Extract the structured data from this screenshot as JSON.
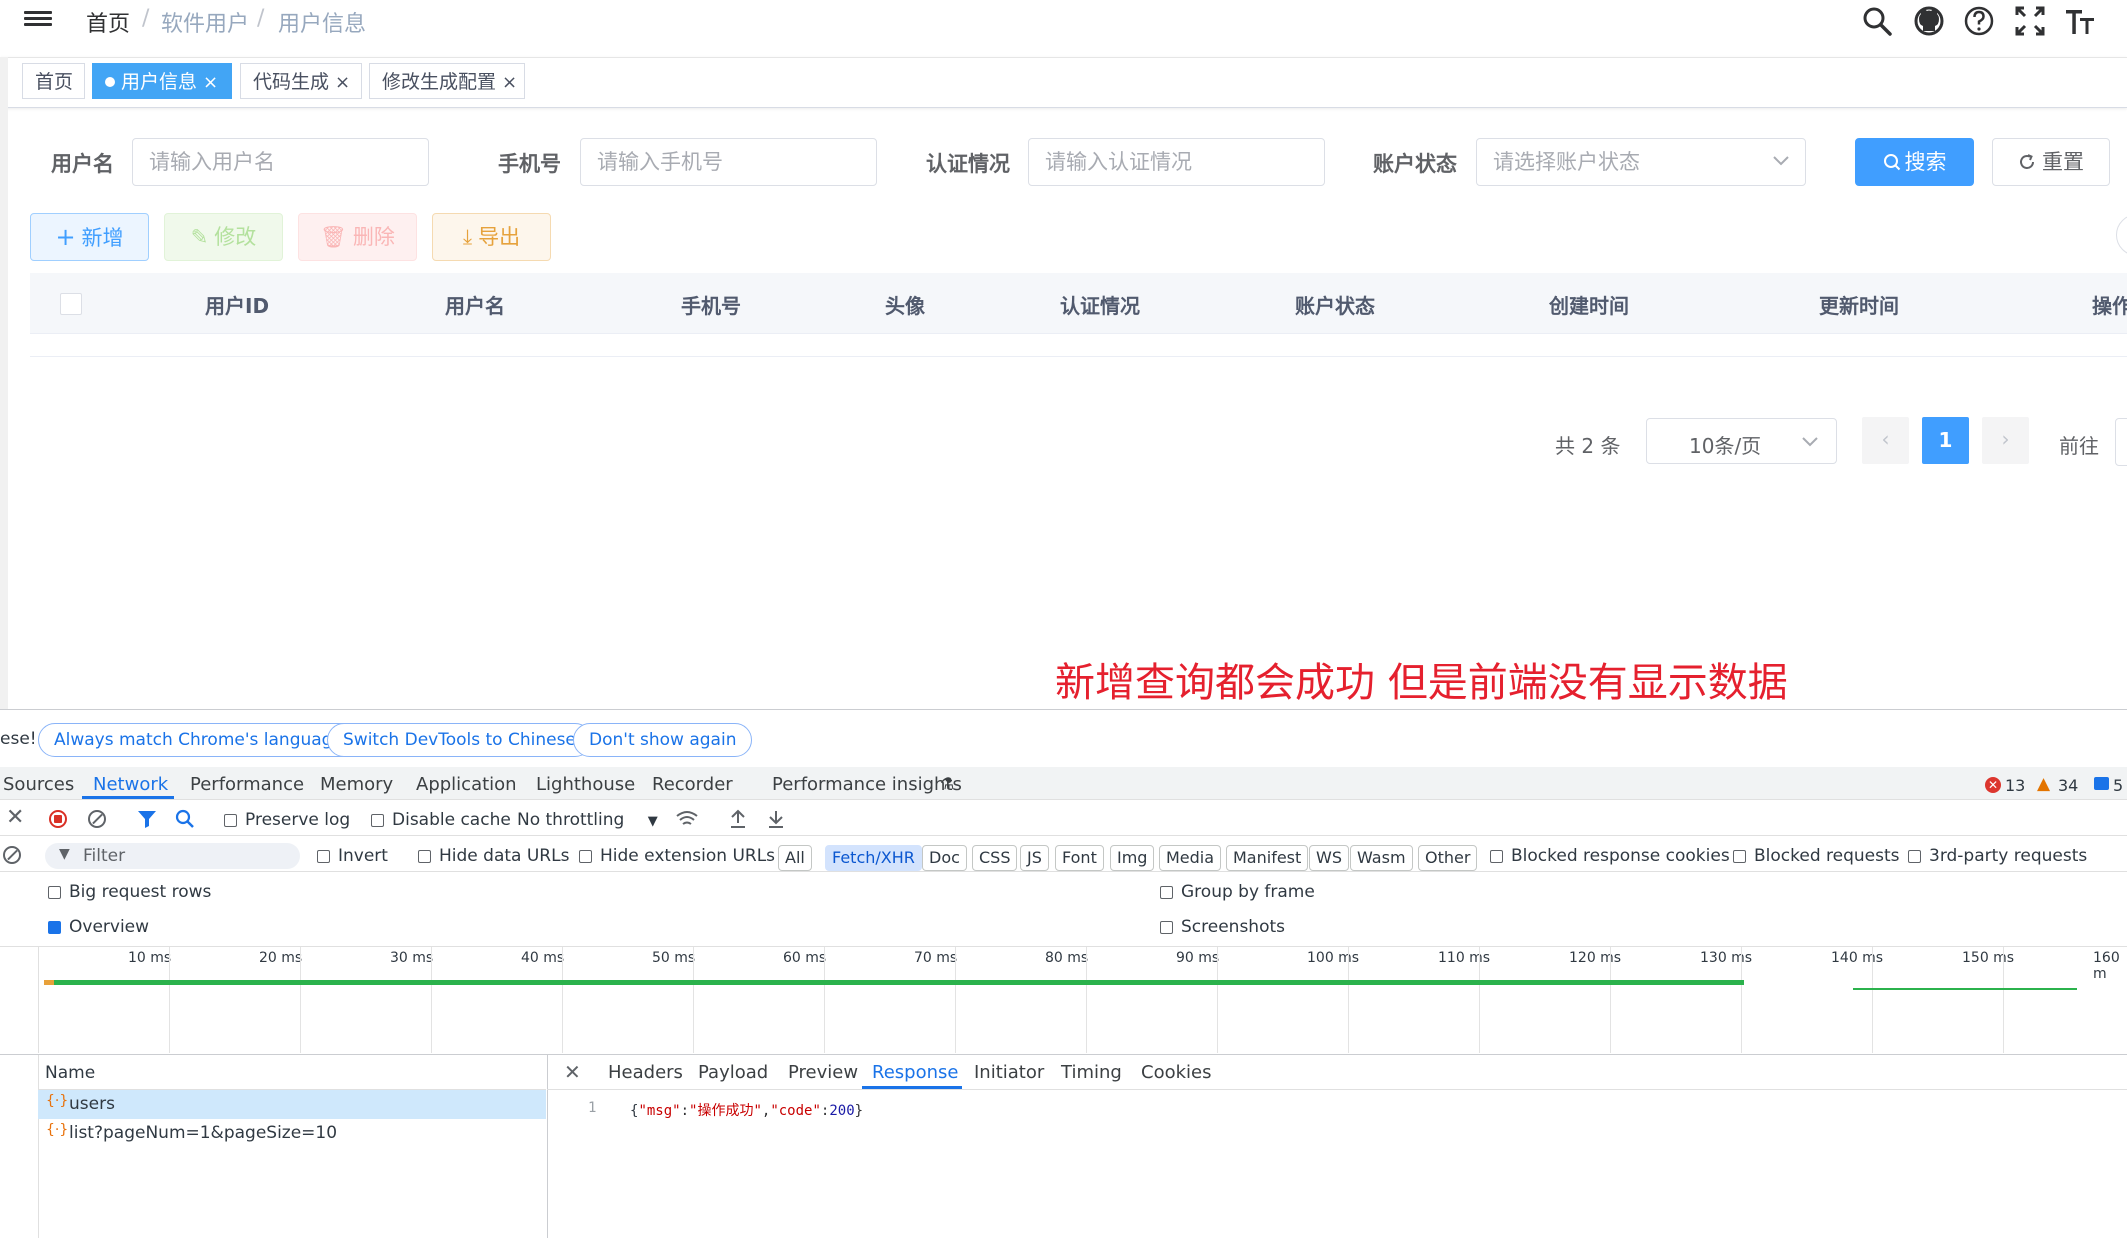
{
  "breadcrumb": {
    "home": "首页",
    "sep": "/",
    "level2": "软件用户",
    "level3": "用户信息"
  },
  "tags": [
    {
      "label": "首页",
      "active": false,
      "closable": false
    },
    {
      "label": "用户信息",
      "active": true,
      "closable": true
    },
    {
      "label": "代码生成",
      "active": false,
      "closable": true
    },
    {
      "label": "修改生成配置",
      "active": false,
      "closable": true
    }
  ],
  "close_glyph": "×",
  "form": {
    "username_label": "用户名",
    "username_placeholder": "请输入用户名",
    "phone_label": "手机号",
    "phone_placeholder": "请输入手机号",
    "auth_label": "认证情况",
    "auth_placeholder": "请输入认证情况",
    "status_label": "账户状态",
    "status_placeholder": "请选择账户状态",
    "search_label": "搜索",
    "reset_label": "重置"
  },
  "actions": {
    "add": "新增",
    "edit": "修改",
    "delete": "删除",
    "export": "导出"
  },
  "table": {
    "columns": [
      "用户ID",
      "用户名",
      "手机号",
      "头像",
      "认证情况",
      "账户状态",
      "创建时间",
      "更新时间",
      "操作"
    ]
  },
  "pagination": {
    "total": "共 2 条",
    "page_size": "10条/页",
    "current_page": "1",
    "goto": "前往"
  },
  "annotation": "新增查询都会成功 但是前端没有显示数据",
  "devtools": {
    "banner": {
      "prefix": "ese!",
      "buttons": [
        "Always match Chrome's language",
        "Switch DevTools to Chinese",
        "Don't show again"
      ]
    },
    "tabs": [
      "Sources",
      "Network",
      "Performance",
      "Memory",
      "Application",
      "Lighthouse",
      "Recorder",
      "Performance insights"
    ],
    "active_tab": "Network",
    "counts": {
      "errors": "13",
      "warnings": "34",
      "messages": "5"
    },
    "toolbar": {
      "preserve_log": "Preserve log",
      "disable_cache": "Disable cache",
      "throttling": "No throttling"
    },
    "filter": {
      "placeholder": "Filter",
      "invert": "Invert",
      "hide_data_urls": "Hide data URLs",
      "hide_extension_urls": "Hide extension URLs"
    },
    "types": [
      "All",
      "Fetch/XHR",
      "Doc",
      "CSS",
      "JS",
      "Font",
      "Img",
      "Media",
      "Manifest",
      "WS",
      "Wasm",
      "Other"
    ],
    "active_type": "Fetch/XHR",
    "extra_filters": [
      "Blocked response cookies",
      "Blocked requests",
      "3rd-party requests"
    ],
    "options": {
      "big_rows": "Big request rows",
      "overview": "Overview",
      "group_by_frame": "Group by frame",
      "screenshots": "Screenshots"
    },
    "timeline_ticks": [
      "10 ms",
      "20 ms",
      "30 ms",
      "40 ms",
      "50 ms",
      "60 ms",
      "70 ms",
      "80 ms",
      "90 ms",
      "100 ms",
      "110 ms",
      "120 ms",
      "130 ms",
      "140 ms",
      "150 ms",
      "160 m"
    ],
    "requests": {
      "header": "Name",
      "items": [
        "users",
        "list?pageNum=1&pageSize=10"
      ],
      "selected": 0
    },
    "response_tabs": [
      "Headers",
      "Payload",
      "Preview",
      "Response",
      "Initiator",
      "Timing",
      "Cookies"
    ],
    "active_response_tab": "Response",
    "response": {
      "line_no": "1",
      "parts": [
        "{",
        "\"msg\"",
        ":",
        "\"操作成功\"",
        ",",
        "\"code\"",
        ":",
        "200",
        "}"
      ]
    }
  }
}
